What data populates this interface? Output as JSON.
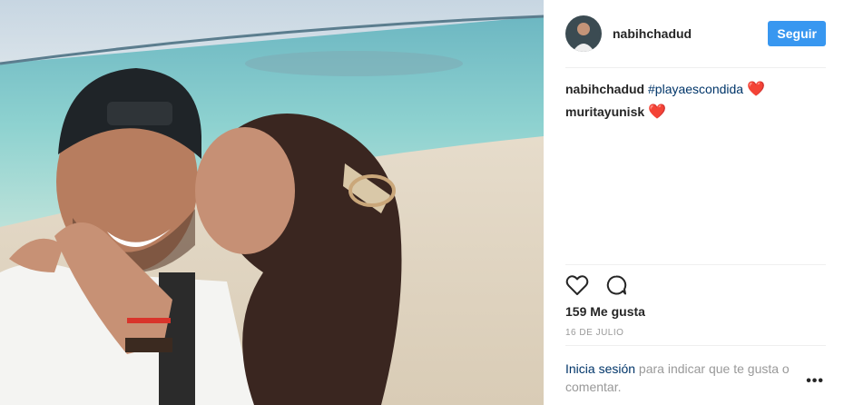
{
  "post": {
    "username": "nabihchadud",
    "follow_label": "Seguir",
    "comments": [
      {
        "user": "nabihchadud",
        "hashtag": "#playaescondida",
        "heart": "❤️"
      },
      {
        "user": "muritayunisk",
        "heart": "❤️"
      }
    ],
    "likes": "159 Me gusta",
    "date": "16 DE JULIO",
    "login_link": "Inicia sesión",
    "login_rest": " para indicar que te gusta o comentar.",
    "more": "•••"
  },
  "icons": [
    "heart-outline-icon",
    "comment-icon",
    "more-options-icon"
  ],
  "colors": {
    "accent": "#3897f0",
    "link": "#003569",
    "heart": "#ed1b24"
  }
}
